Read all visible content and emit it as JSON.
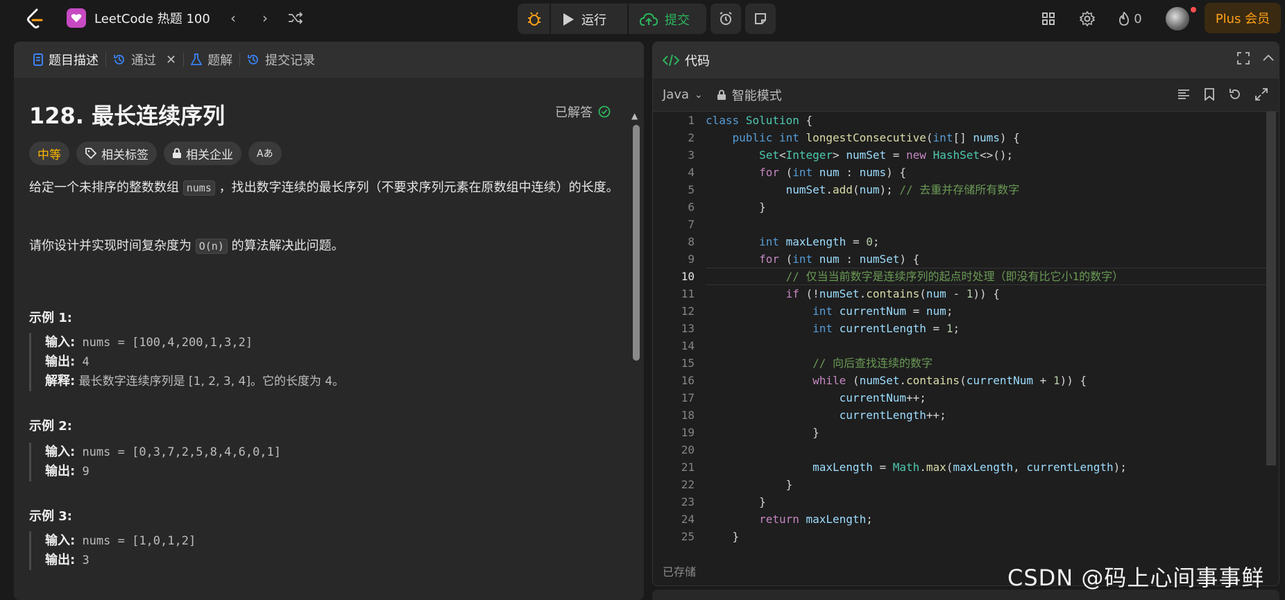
{
  "topbar": {
    "app_title": "LeetCode 热题 100",
    "run_label": "运行",
    "submit_label": "提交",
    "fire_count": "0",
    "plus_label": "Plus 会员"
  },
  "left": {
    "tabs": [
      {
        "label": "题目描述"
      },
      {
        "label": "通过"
      },
      {
        "label": "题解"
      },
      {
        "label": "提交记录"
      }
    ],
    "title": "128. 最长连续序列",
    "solved": "已解答",
    "tags": {
      "difficulty": "中等",
      "related_tags": "相关标签",
      "companies": "相关企业",
      "translate": "Aあ"
    },
    "desc1a": "给定一个未排序的整数数组 ",
    "desc1_code": "nums",
    "desc1b": " ，找出数字连续的最长序列（不要求序列元素在原数组中连续）的长度。",
    "desc2a": "请你设计并实现时间复杂度为 ",
    "desc2_code": "O(n)",
    "desc2b": " 的算法解决此问题。",
    "examples": [
      {
        "title": "示例 1:",
        "input_label": "输入:",
        "input": " nums = [100,4,200,1,3,2]",
        "output_label": "输出:",
        "output": " 4",
        "explain_label": "解释:",
        "explain": " 最长数字连续序列是 [1, 2, 3, 4]。它的长度为 4。"
      },
      {
        "title": "示例 2:",
        "input_label": "输入:",
        "input": " nums = [0,3,7,2,5,8,4,6,0,1]",
        "output_label": "输出:",
        "output": " 9"
      },
      {
        "title": "示例 3:",
        "input_label": "输入:",
        "input": " nums = [1,0,1,2]",
        "output_label": "输出:",
        "output": " 3"
      }
    ]
  },
  "editor": {
    "header": "代码",
    "language": "Java",
    "mode": "智能模式",
    "status": "已存储",
    "current_line": 10,
    "lines": [
      "class Solution {",
      "    public int longestConsecutive(int[] nums) {",
      "        Set<Integer> numSet = new HashSet<>();",
      "        for (int num : nums) {",
      "            numSet.add(num); // 去重并存储所有数字",
      "        }",
      "",
      "        int maxLength = 0;",
      "        for (int num : numSet) {",
      "            // 仅当当前数字是连续序列的起点时处理（即没有比它小1的数字）",
      "            if (!numSet.contains(num - 1)) {",
      "                int currentNum = num;",
      "                int currentLength = 1;",
      "",
      "                // 向后查找连续的数字",
      "                while (numSet.contains(currentNum + 1)) {",
      "                    currentNum++;",
      "                    currentLength++;",
      "                }",
      "",
      "                maxLength = Math.max(maxLength, currentLength);",
      "            }",
      "        }",
      "        return maxLength;",
      "    }"
    ]
  },
  "watermark": "CSDN @码上心间事事鲜",
  "colors": {
    "accent_green": "#2db55d",
    "difficulty_yellow": "#ffb800",
    "plus_orange": "#ffa116"
  }
}
